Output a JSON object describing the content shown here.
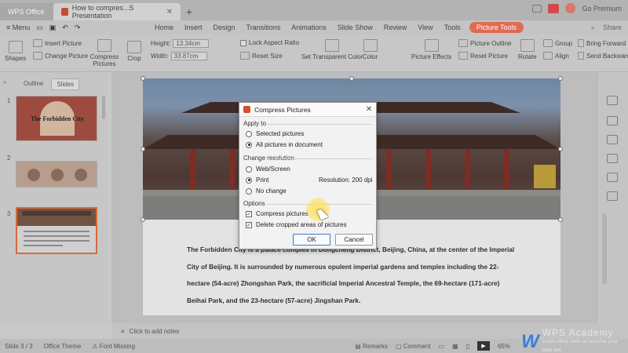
{
  "titlebar": {
    "app_tab": "WPS Office",
    "doc_tab": "How to compres...S Presentation",
    "user": "Go Premium"
  },
  "menubar": {
    "menu_label": "Menu",
    "items": [
      "Home",
      "Insert",
      "Design",
      "Transitions",
      "Animations",
      "Slide Show",
      "Review",
      "View",
      "Tools",
      "Picture Tools"
    ],
    "right": [
      "Share"
    ]
  },
  "ribbon": {
    "insert_picture": "Insert Picture",
    "change_picture": "Change Picture",
    "shapes": "Shapes",
    "compress_pictures": "Compress Pictures",
    "crop": "Crop",
    "height_label": "Height:",
    "height_value": "13.34cm",
    "width_label": "Width:",
    "width_value": "33.87cm",
    "lock_aspect": "Lock Aspect Ratio",
    "reset_size": "Reset Size",
    "set_transparent": "Set Transparent Color",
    "color": "Color",
    "picture_effects": "Picture Effects",
    "picture_outline": "Picture Outline",
    "reset_picture": "Reset Picture",
    "rotate": "Rotate",
    "group": "Group",
    "align": "Align",
    "bring_forward": "Bring Forward",
    "send_backward": "Send Backward"
  },
  "leftpanel": {
    "tabs": [
      "Outline",
      "Slides"
    ],
    "slide_numbers": [
      "1",
      "2",
      "3"
    ],
    "thumb1_title": "The Forbidden City"
  },
  "slide": {
    "paragraph": "The Forbidden City is a palace complex in Dongcheng District, Beijing, China, at the center of the Imperial City of Beijing. It is surrounded by numerous opulent imperial gardens and temples including the 22-hectare (54-acre) Zhongshan Park, the sacrificial Imperial Ancestral Temple, the 69-hectare (171-acre) Beihai Park, and the 23-hectare (57-acre) Jingshan Park."
  },
  "notesbar": {
    "text": "Click to add notes"
  },
  "statusbar": {
    "slide_info": "Slide 3 / 3",
    "theme": "Office Theme",
    "font_missing": "Font Missing",
    "remarks": "Remarks",
    "comment": "Comment",
    "zoom": "65%"
  },
  "watermark": {
    "logo": "W",
    "title": "WPS Academy",
    "subtitle": "Learn office skills to become your best self"
  },
  "dialog": {
    "title": "Compress Pictures",
    "apply_to_label": "Apply to",
    "apply_selected": "Selected pictures",
    "apply_all": "All pictures in document",
    "resolution_label": "Change resolution",
    "res_web": "Web/Screen",
    "res_print": "Print",
    "res_nochange": "No change",
    "resolution_value": "Resolution: 200 dpi",
    "options_label": "Options",
    "opt_compress": "Compress pictures",
    "opt_delete_cropped": "Delete cropped areas of pictures",
    "ok": "OK",
    "cancel": "Cancel"
  },
  "colors": {
    "accent": "#e06a52",
    "ok_border": "#3b7fd0",
    "watermark_blue": "#3a7fd8"
  }
}
